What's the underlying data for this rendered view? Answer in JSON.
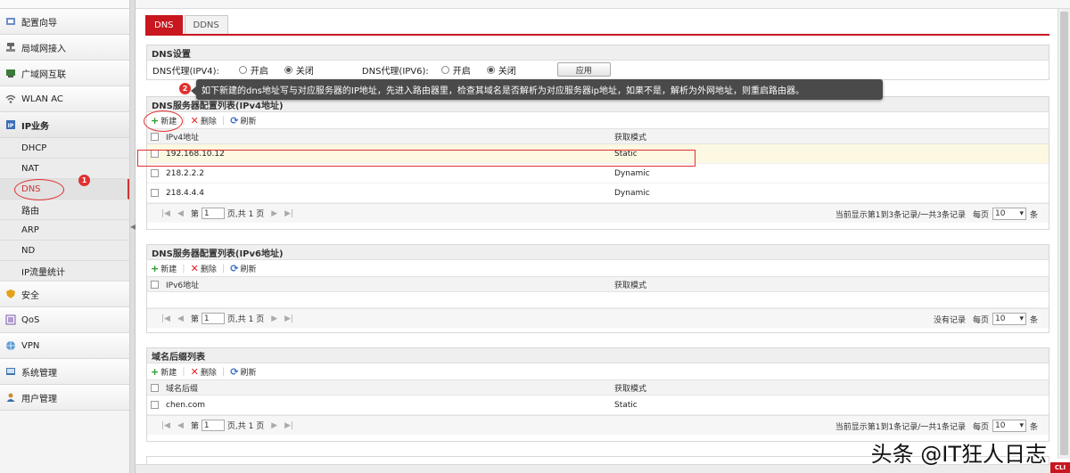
{
  "sidebar": {
    "items": [
      {
        "label": "配置向导",
        "icon": "wand-icon"
      },
      {
        "label": "局域网接入",
        "icon": "lan-icon"
      },
      {
        "label": "广域网互联",
        "icon": "wan-icon"
      },
      {
        "label": "WLAN AC",
        "icon": "wifi-icon"
      },
      {
        "label": "IP业务",
        "icon": "ip-icon"
      }
    ],
    "sub_items": [
      "DHCP",
      "NAT",
      "DNS",
      "路由",
      "ARP",
      "ND",
      "IP流量统计"
    ],
    "bottom_items": [
      {
        "label": "安全",
        "icon": "shield-icon"
      },
      {
        "label": "QoS",
        "icon": "qos-icon"
      },
      {
        "label": "VPN",
        "icon": "vpn-icon"
      },
      {
        "label": "系统管理",
        "icon": "system-icon"
      },
      {
        "label": "用户管理",
        "icon": "user-icon"
      }
    ]
  },
  "tabs": [
    "DNS",
    "DDNS"
  ],
  "dns_settings": {
    "title": "DNS设置",
    "ipv4_label": "DNS代理(IPV4):",
    "ipv6_label": "DNS代理(IPV6):",
    "on": "开启",
    "off": "关闭",
    "apply": "应用"
  },
  "tooltip": "如下新建的dns地址写与对应服务器的IP地址，先进入路由器里，检查其域名是否解析为对应服务器ip地址，如果不是，解析为外网地址，则重启路由器。",
  "badges": [
    "1",
    "2"
  ],
  "toolbar": {
    "new": "新建",
    "delete": "删除",
    "refresh": "刷新"
  },
  "ipv4_list": {
    "title": "DNS服务器配置列表(IPv4地址)",
    "col_addr": "IPv4地址",
    "col_mode": "获取模式",
    "rows": [
      {
        "addr": "192.168.10.12",
        "mode": "Static"
      },
      {
        "addr": "218.2.2.2",
        "mode": "Dynamic"
      },
      {
        "addr": "218.4.4.4",
        "mode": "Dynamic"
      }
    ],
    "pager_status": "当前显示第1到3条记录/一共3条记录"
  },
  "ipv6_list": {
    "title": "DNS服务器配置列表(IPv6地址)",
    "col_addr": "IPv6地址",
    "col_mode": "获取模式",
    "pager_status": "没有记录"
  },
  "suffix_list": {
    "title": "域名后缀列表",
    "col_addr": "域名后缀",
    "col_mode": "获取模式",
    "rows": [
      {
        "addr": "chen.com",
        "mode": "Static"
      }
    ],
    "pager_status": "当前显示第1到1条记录/一共1条记录"
  },
  "pager": {
    "page_prefix": "第",
    "page_value": "1",
    "page_suffix": "页,共 1 页",
    "per_page": "每页",
    "per_page_value": "10",
    "unit": "条"
  },
  "watermark": "头条 @IT狂人日志",
  "cli": "CLI",
  "colors": {
    "accent": "#c8171f",
    "annotation": "#e0312f"
  }
}
